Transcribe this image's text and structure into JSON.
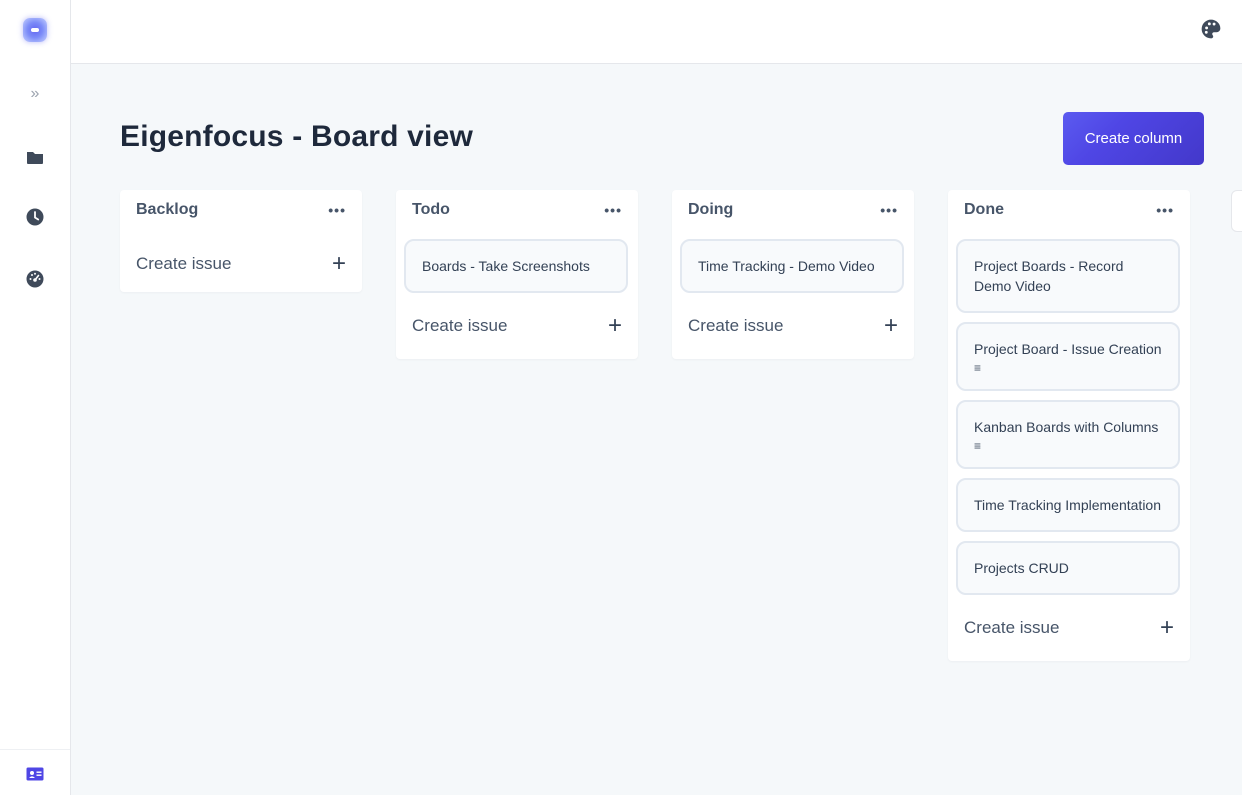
{
  "page": {
    "title": "Eigenfocus - Board view",
    "create_column_label": "Create column"
  },
  "sidebar": {
    "expand_symbol": "»",
    "icons": [
      "logo-icon",
      "folder-icon",
      "clock-icon",
      "dashboard-icon",
      "profile-card-icon"
    ]
  },
  "topbar": {
    "icons": [
      "palette-icon"
    ]
  },
  "columns": [
    {
      "title": "Backlog",
      "menu": "•••",
      "create_issue": "Create issue",
      "plus": "+",
      "issues": []
    },
    {
      "title": "Todo",
      "menu": "•••",
      "create_issue": "Create issue",
      "plus": "+",
      "issues": [
        {
          "title": "Boards - Take Screenshots",
          "has_description": false
        }
      ]
    },
    {
      "title": "Doing",
      "menu": "•••",
      "create_issue": "Create issue",
      "plus": "+",
      "issues": [
        {
          "title": "Time Tracking - Demo Video",
          "has_description": false
        }
      ]
    },
    {
      "title": "Done",
      "menu": "•••",
      "create_issue": "Create issue",
      "plus": "+",
      "issues": [
        {
          "title": "Project Boards - Record Demo Video",
          "has_description": false
        },
        {
          "title": "Project Board - Issue Creation",
          "has_description": true
        },
        {
          "title": "Kanban Boards with Columns",
          "has_description": true
        },
        {
          "title": "Time Tracking Implementation",
          "has_description": false
        },
        {
          "title": "Projects CRUD",
          "has_description": false
        }
      ]
    }
  ],
  "colors": {
    "accent": "#4f46e5",
    "background": "#f5f8fa",
    "card_border": "#e2e8f0",
    "text_dark": "#1e293b"
  }
}
